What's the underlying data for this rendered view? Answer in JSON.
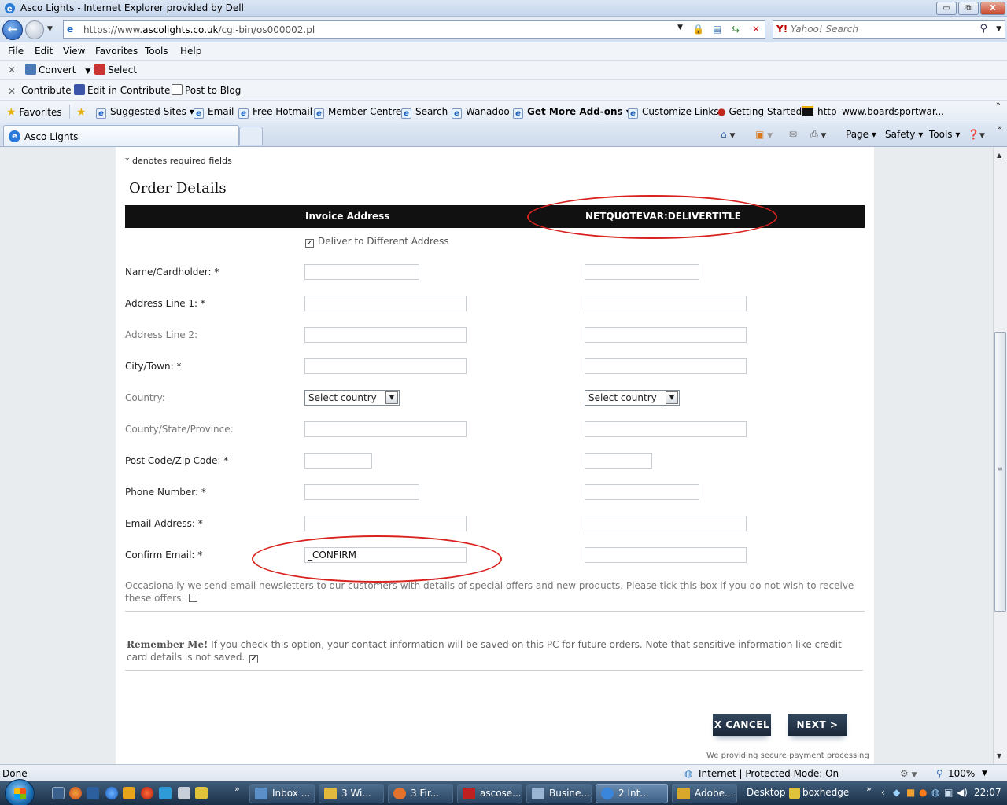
{
  "window": {
    "title": "Asco Lights - Internet Explorer provided by Dell",
    "minimize": "▭",
    "maximize": "⧉",
    "close": "X"
  },
  "address": {
    "url_prefix": "https://www.",
    "url_domain": "ascolights.co.uk",
    "url_path": "/cgi-bin/os000002.pl",
    "search_placeholder": "Yahoo! Search"
  },
  "menu": [
    "File",
    "Edit",
    "View",
    "Favorites",
    "Tools",
    "Help"
  ],
  "toolbar1": {
    "convert": "Convert",
    "select": "Select"
  },
  "toolbar2": {
    "contribute": "Contribute",
    "edit_in_contribute": "Edit in Contribute",
    "post_to_blog": "Post to Blog"
  },
  "favorites_bar": {
    "favorites": "Favorites",
    "items": [
      "Suggested Sites ▾",
      "Email",
      "Free Hotmail",
      "Member Centre",
      "Search",
      "Wanadoo",
      "Get More Add-ons ▾",
      "Customize Links",
      "Getting Started",
      "http",
      "www.boardsportwar..."
    ]
  },
  "tab": {
    "label": "Asco Lights"
  },
  "commandbar": {
    "page": "Page ▾",
    "safety": "Safety ▾",
    "tools": "Tools ▾"
  },
  "form": {
    "required_note": "* denotes required fields",
    "heading": "Order Details",
    "col_invoice": "Invoice Address",
    "col_delivery": "NETQUOTEVAR:DELIVERTITLE",
    "deliver_label": "Deliver to Different Address",
    "labels": {
      "name": "Name/Cardholder: *",
      "addr1": "Address Line 1: *",
      "addr2": "Address Line 2:",
      "city": "City/Town: *",
      "country": "Country:",
      "county": "County/State/Province:",
      "postcode": "Post Code/Zip Code: *",
      "phone": "Phone Number: *",
      "email": "Email Address: *",
      "confirm": "Confirm Email: *"
    },
    "country_select": "Select country",
    "confirm_value": "_CONFIRM",
    "newsletter": "Occasionally we send email newsletters to our customers with details of special offers and new products. Please tick this box if you do not wish to receive these offers:",
    "remember_bold": "Remember Me!",
    "remember_text": " If you check this option, your contact information will be saved on this PC for future orders. Note that sensitive information like credit card details is not saved.",
    "cancel": "X CANCEL",
    "next": "NEXT >",
    "secure_note": "We providing secure payment processing"
  },
  "status": {
    "left": "Done",
    "zone": "Internet | Protected Mode: On",
    "zoom": "100%"
  },
  "taskbar": {
    "tasks": [
      "Inbox ...",
      "3 Wi...",
      "3 Fir...",
      "ascose...",
      "Busine...",
      "2 Int...",
      "Adobe..."
    ],
    "desktop": "Desktop",
    "boxhedge": "boxhedge",
    "time": "22:07"
  },
  "colors": {
    "annotation": "#d9221e",
    "header_bar": "#111111",
    "button": "#23344a"
  }
}
